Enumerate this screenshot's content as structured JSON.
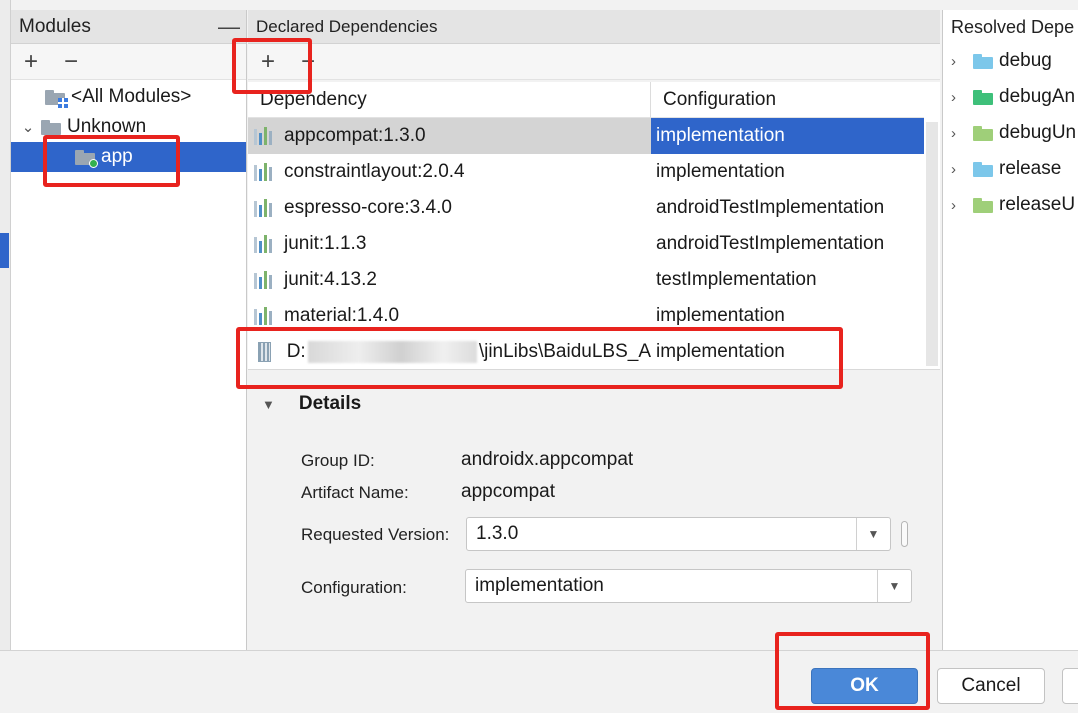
{
  "modules_panel": {
    "title": "Modules",
    "minimize_glyph": "—",
    "toolbar": {
      "add": "+",
      "remove": "−"
    },
    "tree": [
      {
        "label": "<All Modules>",
        "icon": "modules-folder-icon"
      },
      {
        "label": "Unknown",
        "icon": "folder-icon",
        "expanded": true
      },
      {
        "label": "app",
        "icon": "module-folder-icon",
        "selected": true
      }
    ],
    "tree_expand_glyph": "⌄"
  },
  "declared_panel": {
    "title": "Declared Dependencies",
    "toolbar": {
      "add": "+",
      "remove": "−"
    },
    "columns": [
      "Dependency",
      "Configuration"
    ],
    "rows": [
      {
        "dependency": "appcompat:1.3.0",
        "configuration": "implementation",
        "selected": true
      },
      {
        "dependency": "constraintlayout:2.0.4",
        "configuration": "implementation"
      },
      {
        "dependency": "espresso-core:3.4.0",
        "configuration": "androidTestImplementation"
      },
      {
        "dependency": "junit:1.1.3",
        "configuration": "androidTestImplementation"
      },
      {
        "dependency": "junit:4.13.2",
        "configuration": "testImplementation"
      },
      {
        "dependency": "material:1.4.0",
        "configuration": "implementation"
      }
    ],
    "jar_row": {
      "path_prefix": "D:",
      "path_suffix": "\\jinLibs\\BaiduLBS_A",
      "configuration": "implementation"
    }
  },
  "details": {
    "title": "Details",
    "collapse_glyph": "▼",
    "group_id_label": "Group ID:",
    "group_id": "androidx.appcompat",
    "artifact_label": "Artifact Name:",
    "artifact": "appcompat",
    "requested_version_label": "Requested Version:",
    "requested_version": "1.3.0",
    "configuration_label": "Configuration:",
    "configuration": "implementation",
    "dropdown_glyph": "▼"
  },
  "resolved_panel": {
    "title": "Resolved Depe",
    "expand_glyph": "›",
    "items": [
      {
        "label": "debug",
        "folder_color": "#7cc7ea"
      },
      {
        "label": "debugAn",
        "folder_color": "#3ec07a"
      },
      {
        "label": "debugUn",
        "folder_color": "#9fcf79"
      },
      {
        "label": "release",
        "folder_color": "#7cc7ea"
      },
      {
        "label": "releaseU",
        "folder_color": "#9fcf79"
      }
    ]
  },
  "footer": {
    "ok": "OK",
    "cancel": "Cancel"
  },
  "colors": {
    "selection": "#2f65ca",
    "ok_button": "#4a88d8",
    "annotation": "#e8231e"
  }
}
